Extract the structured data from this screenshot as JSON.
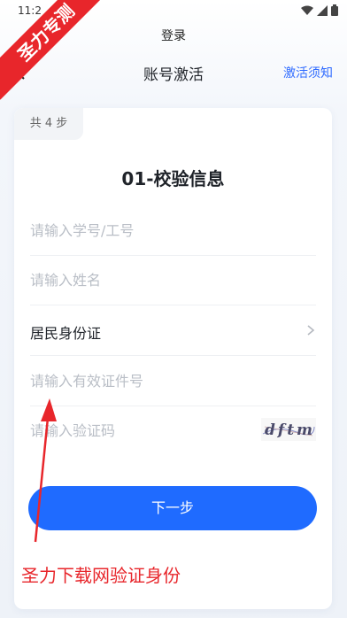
{
  "status": {
    "time": "11:2"
  },
  "header": {
    "top_title": "登录",
    "nav_title": "账号激活",
    "nav_link": "激活须知"
  },
  "card": {
    "step": "共 4 步",
    "title": "01-校验信息",
    "fields": {
      "student_id_placeholder": "请输入学号/工号",
      "name_placeholder": "请输入姓名",
      "id_type_value": "居民身份证",
      "id_number_placeholder": "请输入有效证件号",
      "captcha_placeholder": "请输入验证码",
      "captcha_text": "dftm"
    },
    "next_button": "下一步"
  },
  "watermark": {
    "ribbon": "圣力专测",
    "annotation": "圣力下载网验证身份"
  },
  "colors": {
    "accent": "#1f6bff",
    "link": "#2f6bff",
    "watermark": "#e8262b"
  }
}
